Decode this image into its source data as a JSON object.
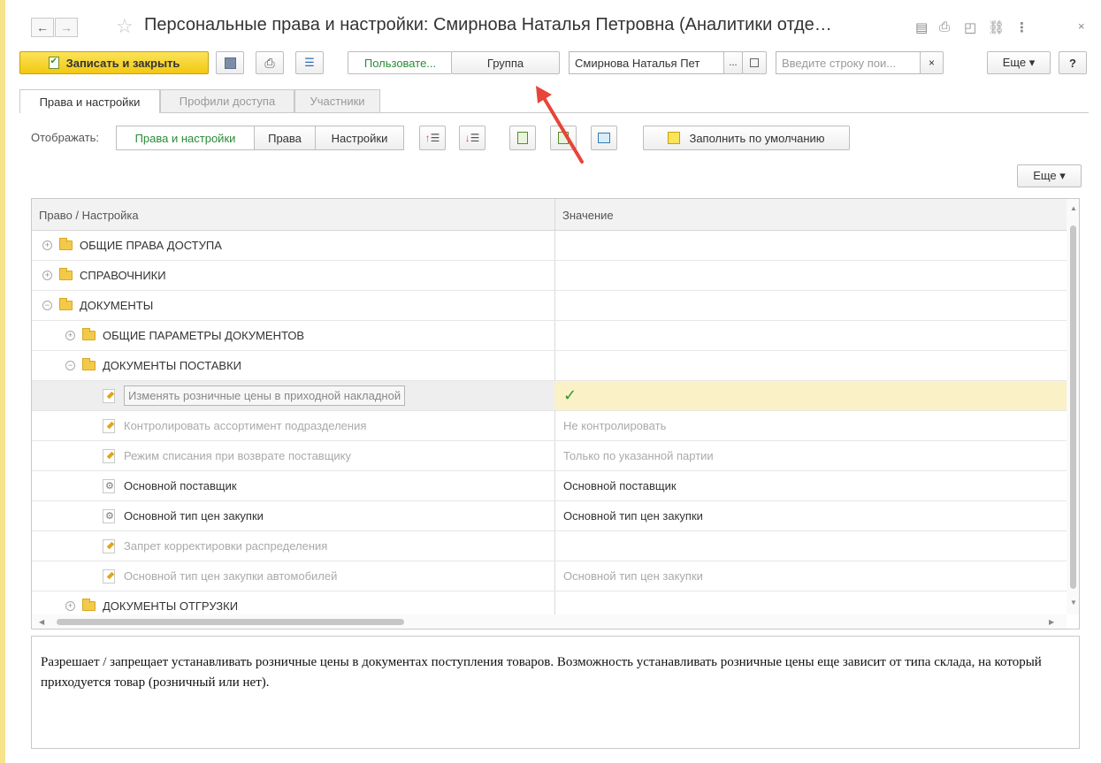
{
  "window": {
    "title": "Персональные права и настройки: Смирнова Наталья Петровна (Аналитики отде…"
  },
  "toolbar": {
    "save_close_label": "Записать и закрыть",
    "mode_user_label": "Пользовате...",
    "mode_group_label": "Группа",
    "user_value": "Смирнова Наталья Пет",
    "user_dots": "...",
    "search_placeholder": "Введите строку пои...",
    "search_clear": "×",
    "more_label": "Еще ▾",
    "help_label": "?"
  },
  "tabs": [
    {
      "label": "Права и настройки",
      "active": true
    },
    {
      "label": "Профили доступа",
      "active": false
    },
    {
      "label": "Участники",
      "active": false
    }
  ],
  "display": {
    "label": "Отображать:",
    "options": [
      "Права и настройки",
      "Права",
      "Настройки"
    ],
    "fill_default_label": "Заполнить по умолчанию",
    "more_label": "Еще ▾"
  },
  "grid": {
    "columns": [
      "Право / Настройка",
      "Значение"
    ],
    "rows": [
      {
        "type": "folder",
        "level": 0,
        "expanded": false,
        "label": "ОБЩИЕ ПРАВА ДОСТУПА",
        "value": ""
      },
      {
        "type": "folder",
        "level": 0,
        "expanded": false,
        "label": "СПРАВОЧНИКИ",
        "value": ""
      },
      {
        "type": "folder",
        "level": 0,
        "expanded": true,
        "label": "ДОКУМЕНТЫ",
        "value": ""
      },
      {
        "type": "folder",
        "level": 1,
        "expanded": false,
        "label": "ОБЩИЕ ПАРАМЕТРЫ ДОКУМЕНТОВ",
        "value": ""
      },
      {
        "type": "folder",
        "level": 1,
        "expanded": true,
        "label": "ДОКУМЕНТЫ ПОСТАВКИ",
        "value": ""
      },
      {
        "type": "right",
        "label": "Изменять розничные цены в приходной накладной",
        "value": "✓",
        "selected": true,
        "dim": false
      },
      {
        "type": "right",
        "label": "Контролировать ассортимент подразделения",
        "value": "Не контролировать",
        "dim": true
      },
      {
        "type": "right",
        "label": "Режим списания при возврате поставщику",
        "value": "Только по указанной партии",
        "dim": true
      },
      {
        "type": "setting",
        "label": "Основной поставщик",
        "value": "Основной поставщик",
        "dim": false
      },
      {
        "type": "setting",
        "label": "Основной тип цен закупки",
        "value": "Основной тип цен закупки",
        "dim": false
      },
      {
        "type": "right",
        "label": "Запрет корректировки распределения",
        "value": "",
        "dim": true
      },
      {
        "type": "right",
        "label": "Основной тип цен закупки автомобилей",
        "value": "Основной тип цен закупки",
        "dim": true
      },
      {
        "type": "folder",
        "level": 1,
        "expanded": false,
        "label": "ДОКУМЕНТЫ ОТГРУЗКИ",
        "value": ""
      }
    ]
  },
  "description": "Разрешает / запрещает устанавливать розничные цены в документах поступления товаров. Возможность устанавливать розничные цены еще зависит от типа склада, на который приходуется товар (розничный или нет).",
  "colors": {
    "primary_button": "#f2c811",
    "selected_row": "#fbf1c6",
    "active_text": "#2a8c37",
    "annotation_arrow": "#e8443a"
  }
}
